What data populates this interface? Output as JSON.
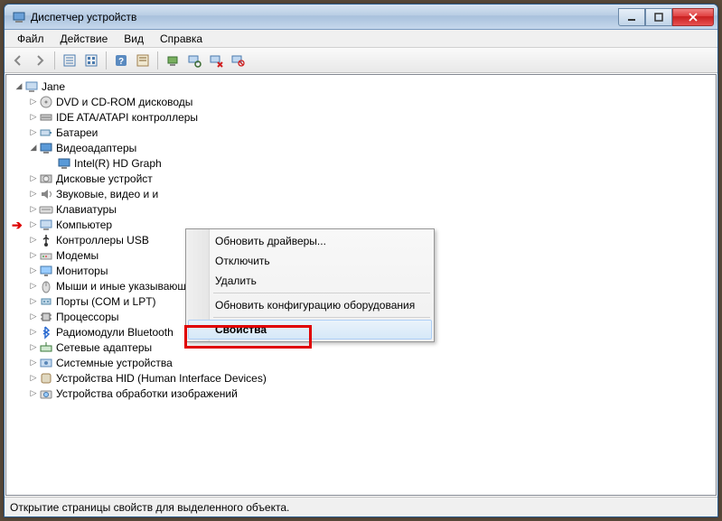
{
  "window": {
    "title": "Диспетчер устройств"
  },
  "menu": {
    "file": "Файл",
    "action": "Действие",
    "view": "Вид",
    "help": "Справка"
  },
  "tree": {
    "root": "Jane",
    "items": [
      {
        "label": "DVD и CD-ROM дисководы",
        "icon": "disc"
      },
      {
        "label": "IDE ATA/ATAPI контроллеры",
        "icon": "ide"
      },
      {
        "label": "Батареи",
        "icon": "battery"
      },
      {
        "label": "Видеоадаптеры",
        "icon": "display",
        "expanded": true,
        "children": [
          {
            "label": "Intel(R) HD Graph",
            "icon": "display"
          }
        ]
      },
      {
        "label": "Дисковые устройст",
        "icon": "hdd"
      },
      {
        "label": "Звуковые, видео и и",
        "icon": "sound"
      },
      {
        "label": "Клавиатуры",
        "icon": "keyboard"
      },
      {
        "label": "Компьютер",
        "icon": "computer"
      },
      {
        "label": "Контроллеры USB",
        "icon": "usb"
      },
      {
        "label": "Модемы",
        "icon": "modem"
      },
      {
        "label": "Мониторы",
        "icon": "monitor"
      },
      {
        "label": "Мыши и иные указывающие устройства",
        "icon": "mouse"
      },
      {
        "label": "Порты (COM и LPT)",
        "icon": "port"
      },
      {
        "label": "Процессоры",
        "icon": "cpu"
      },
      {
        "label": "Радиомодули Bluetooth",
        "icon": "bt"
      },
      {
        "label": "Сетевые адаптеры",
        "icon": "net"
      },
      {
        "label": "Системные устройства",
        "icon": "system"
      },
      {
        "label": "Устройства HID (Human Interface Devices)",
        "icon": "hid"
      },
      {
        "label": "Устройства обработки изображений",
        "icon": "imaging"
      }
    ]
  },
  "contextMenu": {
    "updateDrivers": "Обновить драйверы...",
    "disable": "Отключить",
    "delete": "Удалить",
    "scanHardware": "Обновить конфигурацию оборудования",
    "properties": "Свойства"
  },
  "statusbar": {
    "text": "Открытие страницы свойств для выделенного объекта."
  }
}
